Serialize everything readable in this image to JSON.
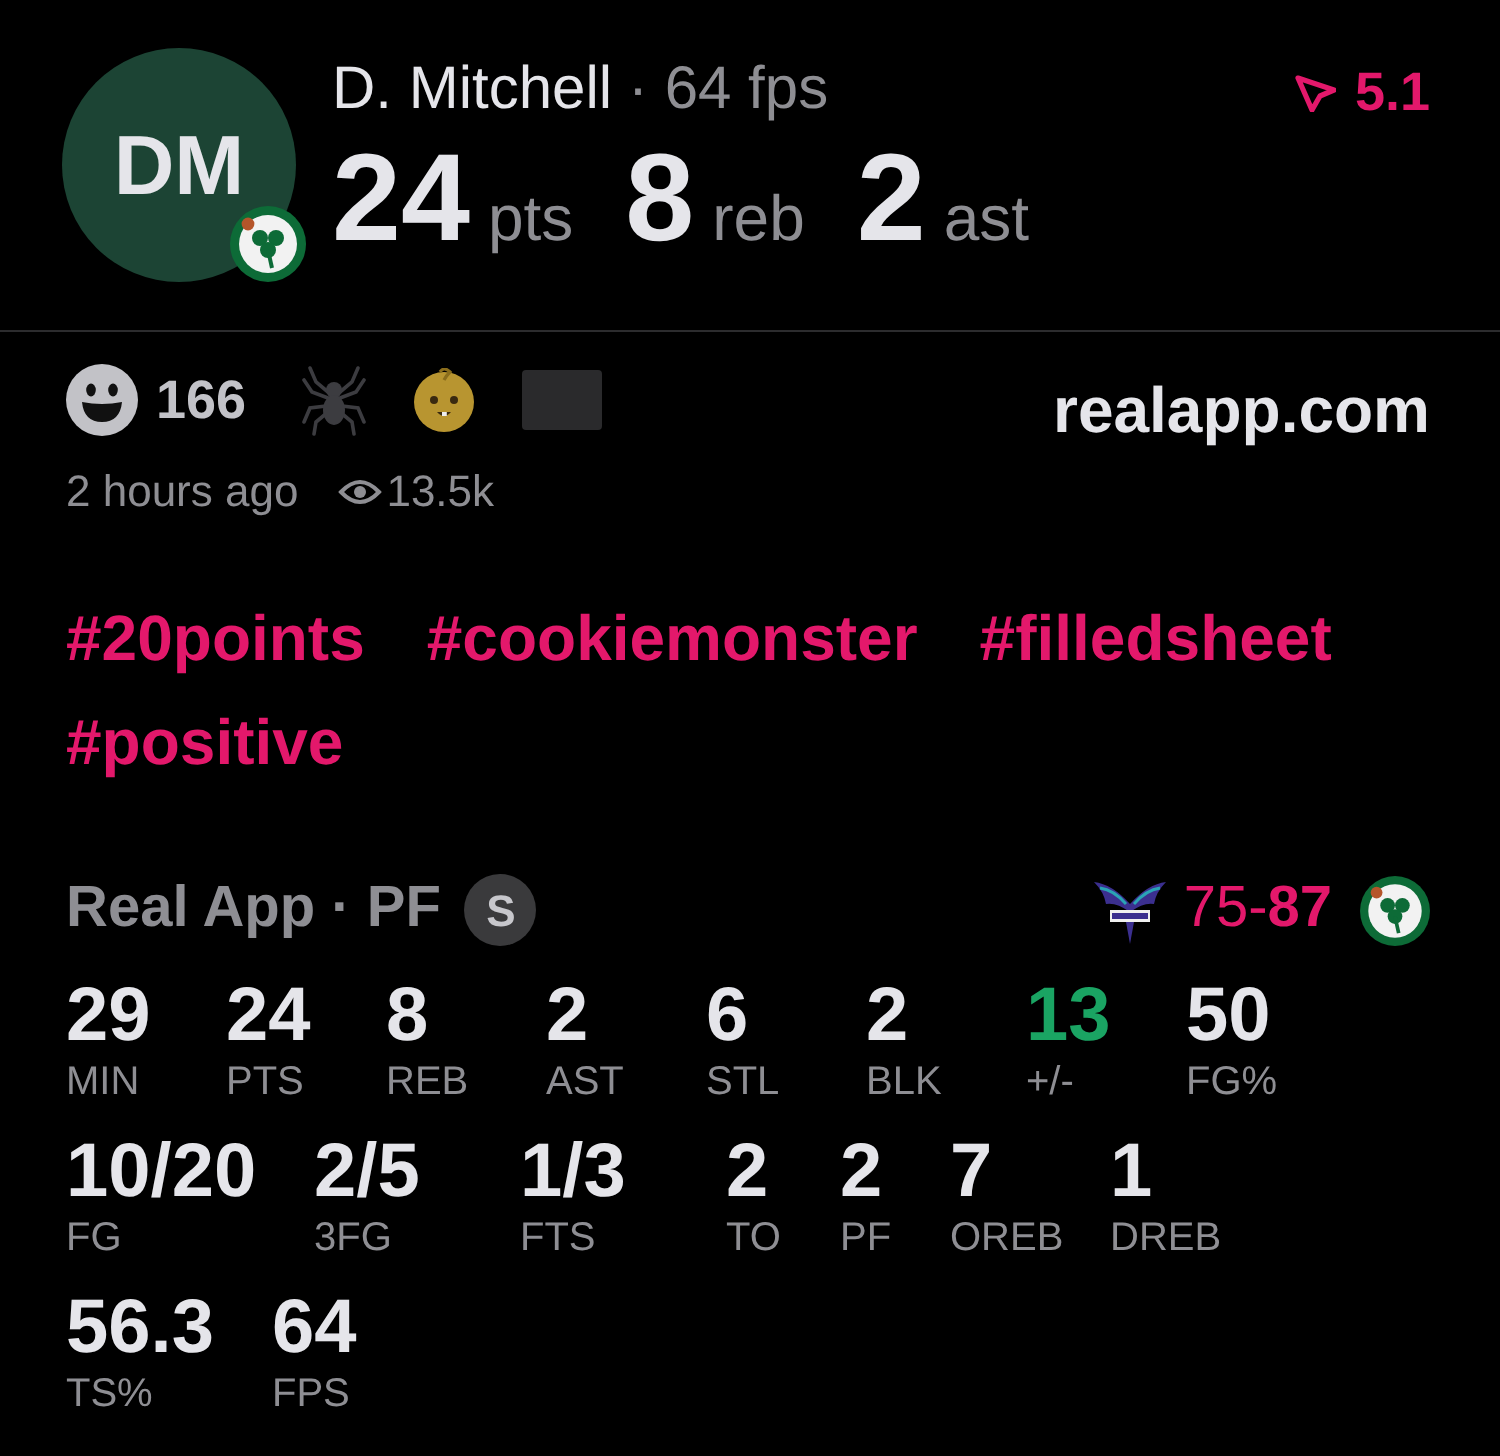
{
  "player": {
    "initials": "DM",
    "name": "D. Mitchell",
    "fps": "· 64 fps"
  },
  "headline": [
    {
      "value": "24",
      "unit": "pts"
    },
    {
      "value": "8",
      "unit": "reb"
    },
    {
      "value": "2",
      "unit": "ast"
    }
  ],
  "rating": "5.1",
  "reactions": {
    "count": "166"
  },
  "meta": {
    "time": "2 hours ago",
    "views": "13.5k"
  },
  "source": "realapp.com",
  "hashtags": [
    "#20points",
    "#cookiemonster",
    "#filledsheet",
    "#positive"
  ],
  "game": {
    "title": "Real App · PF",
    "badge": "S",
    "score": "75-**87**"
  },
  "box_score": [
    [
      {
        "value": "29",
        "label": "MIN"
      },
      {
        "value": "24",
        "label": "PTS"
      },
      {
        "value": "8",
        "label": "REB"
      },
      {
        "value": "2",
        "label": "AST"
      },
      {
        "value": "6",
        "label": "STL"
      },
      {
        "value": "2",
        "label": "BLK"
      },
      {
        "value": "13",
        "label": "+/-",
        "color": "#1aa463"
      },
      {
        "value": "50",
        "label": "FG%"
      }
    ],
    [
      {
        "value": "10/20",
        "label": "FG"
      },
      {
        "value": "2/5",
        "label": "3FG"
      },
      {
        "value": "1/3",
        "label": "FTS"
      },
      {
        "value": "2",
        "label": "TO"
      },
      {
        "value": "2",
        "label": "PF"
      },
      {
        "value": "7",
        "label": "OREB"
      },
      {
        "value": "1",
        "label": "DREB"
      }
    ],
    [
      {
        "value": "56.3",
        "label": "TS%"
      },
      {
        "value": "64",
        "label": "FPS"
      }
    ]
  ]
}
